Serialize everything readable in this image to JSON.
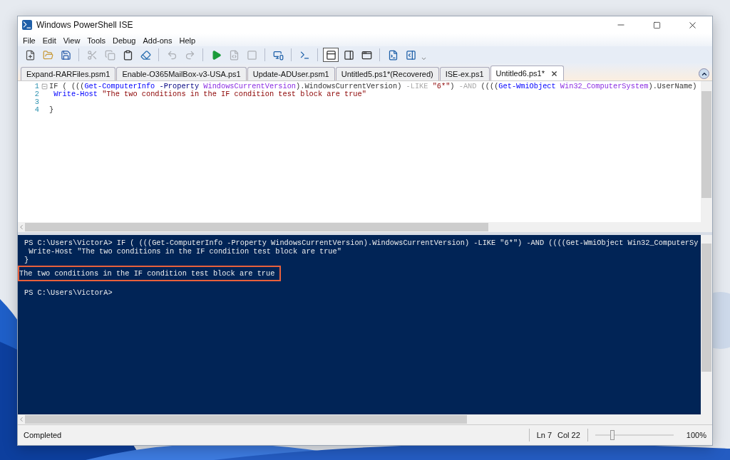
{
  "window": {
    "title": "Windows PowerShell ISE"
  },
  "menu": [
    "File",
    "Edit",
    "View",
    "Tools",
    "Debug",
    "Add-ons",
    "Help"
  ],
  "toolbar": [
    {
      "kind": "new",
      "disabled": false
    },
    {
      "kind": "open",
      "disabled": false
    },
    {
      "kind": "save",
      "disabled": false
    },
    {
      "kind": "sep"
    },
    {
      "kind": "cut",
      "disabled": true
    },
    {
      "kind": "copy",
      "disabled": true
    },
    {
      "kind": "paste",
      "disabled": false
    },
    {
      "kind": "clear",
      "disabled": false
    },
    {
      "kind": "sep"
    },
    {
      "kind": "undo",
      "disabled": true
    },
    {
      "kind": "redo",
      "disabled": true
    },
    {
      "kind": "sep"
    },
    {
      "kind": "run",
      "disabled": false
    },
    {
      "kind": "run-selection",
      "disabled": true
    },
    {
      "kind": "stop",
      "disabled": true
    },
    {
      "kind": "sep"
    },
    {
      "kind": "remote",
      "disabled": false
    },
    {
      "kind": "sep"
    },
    {
      "kind": "console",
      "disabled": false
    },
    {
      "kind": "sep"
    },
    {
      "kind": "layout-top",
      "disabled": false,
      "selected": true
    },
    {
      "kind": "layout-right",
      "disabled": false,
      "selected": false
    },
    {
      "kind": "layout-max",
      "disabled": false,
      "selected": false
    },
    {
      "kind": "sep"
    },
    {
      "kind": "show-script",
      "disabled": false
    },
    {
      "kind": "show-commands",
      "disabled": false
    },
    {
      "kind": "more"
    }
  ],
  "tabs": [
    {
      "label": "Expand-RARFiles.psm1",
      "selected": false
    },
    {
      "label": "Enable-O365MailBox-v3-USA.ps1",
      "selected": false
    },
    {
      "label": "Update-ADUser.psm1",
      "selected": false
    },
    {
      "label": "Untitled5.ps1*(Recovered)",
      "selected": false
    },
    {
      "label": "ISE-ex.ps1",
      "selected": false
    },
    {
      "label": "Untitled6.ps1*",
      "selected": true
    }
  ],
  "editor": {
    "lines": [
      {
        "number": "1",
        "folded": false,
        "tokens": [
          {
            "kind": "plain",
            "text": "IF ( ((("
          },
          {
            "kind": "command",
            "text": "Get-ComputerInfo"
          },
          {
            "kind": "parameter",
            "text": " -Property"
          },
          {
            "kind": "argument",
            "text": " WindowsCurrentVersion"
          },
          {
            "kind": "plain",
            "text": ").WindowsCurrentVersion) "
          },
          {
            "kind": "operator",
            "text": "-LIKE"
          },
          {
            "kind": "string",
            "text": " \"6*\""
          },
          {
            "kind": "plain",
            "text": ") "
          },
          {
            "kind": "operator",
            "text": "-AND"
          },
          {
            "kind": "plain",
            "text": " (((("
          },
          {
            "kind": "command",
            "text": "Get-WmiObject"
          },
          {
            "kind": "argument",
            "text": " Win32_ComputerSystem"
          },
          {
            "kind": "plain",
            "text": ").UserName)"
          }
        ]
      },
      {
        "number": "2",
        "tokens": [
          {
            "kind": "command",
            "text": " Write-Host"
          },
          {
            "kind": "string",
            "text": " \"The two conditions in the IF condition test block are true\""
          }
        ]
      },
      {
        "number": "3"
      },
      {
        "number": "4",
        "tokens": [
          {
            "kind": "plain",
            "text": "}"
          }
        ]
      }
    ]
  },
  "console": {
    "lines": [
      {
        "text": "PS C:\\Users\\VictorA> IF ( (((Get-ComputerInfo -Property WindowsCurrentVersion).WindowsCurrentVersion) -LIKE \"6*\") -AND ((((Get-WmiObject Win32_ComputerSy",
        "highlighted": false
      },
      {
        "text": " Write-Host \"The two conditions in the IF condition test block are true\"",
        "highlighted": false
      },
      {
        "text": "}",
        "highlighted": false
      },
      {
        "text": "The two conditions in the IF condition test block are true",
        "highlighted": true
      },
      {
        "text": "PS C:\\Users\\VictorA>",
        "highlighted": false
      }
    ]
  },
  "status_bar": {
    "message": "Completed",
    "line": "Ln 7",
    "column": "Col 22",
    "zoom": {
      "level": 0.22,
      "reading": "100%"
    }
  }
}
